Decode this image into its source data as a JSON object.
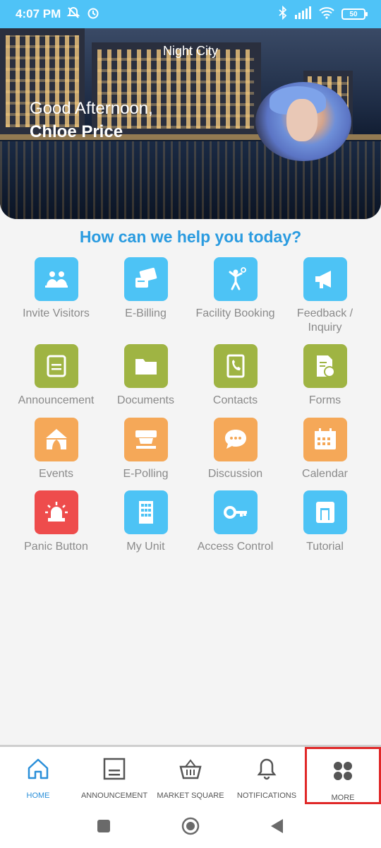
{
  "status_bar": {
    "time": "4:07 PM",
    "battery": "50",
    "icons": [
      "mute-icon",
      "alarm-icon",
      "bluetooth-icon",
      "signal-icon",
      "wifi-icon",
      "battery-icon"
    ]
  },
  "hero": {
    "location": "Night City",
    "greeting": "Good Afternoon,",
    "user_name": "Chloe Price"
  },
  "headline": "How can we help you today?",
  "services": [
    {
      "label": "Invite Visitors",
      "icon": "invite-visitors-icon",
      "color": "#4dc3f5"
    },
    {
      "label": "E-Billing",
      "icon": "billing-card-icon",
      "color": "#4dc3f5"
    },
    {
      "label": "Facility Booking",
      "icon": "badminton-player-icon",
      "color": "#4dc3f5"
    },
    {
      "label": "Feedback / Inquiry",
      "icon": "megaphone-icon",
      "color": "#4dc3f5"
    },
    {
      "label": "Announcement",
      "icon": "announcement-icon",
      "color": "#9fb443"
    },
    {
      "label": "Documents",
      "icon": "folder-icon",
      "color": "#9fb443"
    },
    {
      "label": "Contacts",
      "icon": "phone-book-icon",
      "color": "#9fb443"
    },
    {
      "label": "Forms",
      "icon": "form-icon",
      "color": "#9fb443"
    },
    {
      "label": "Events",
      "icon": "tent-icon",
      "color": "#f5a858"
    },
    {
      "label": "E-Polling",
      "icon": "ballot-icon",
      "color": "#f5a858"
    },
    {
      "label": "Discussion",
      "icon": "chat-bubble-icon",
      "color": "#f5a858"
    },
    {
      "label": "Calendar",
      "icon": "calendar-icon",
      "color": "#f5a858"
    },
    {
      "label": "Panic Button",
      "icon": "siren-icon",
      "color": "#ee4c4c"
    },
    {
      "label": "My Unit",
      "icon": "building-icon",
      "color": "#4dc3f5"
    },
    {
      "label": "Access Control",
      "icon": "key-icon",
      "color": "#4dc3f5"
    },
    {
      "label": "Tutorial",
      "icon": "tutorial-book-icon",
      "color": "#4dc3f5"
    }
  ],
  "bottom_nav": [
    {
      "label": "HOME",
      "icon": "home-icon",
      "active": true
    },
    {
      "label": "ANNOUNCEMENT",
      "icon": "announcement-icon"
    },
    {
      "label": "MARKET SQUARE",
      "icon": "basket-icon"
    },
    {
      "label": "NOTIFICATIONS",
      "icon": "bell-icon"
    },
    {
      "label": "MORE",
      "icon": "more-grid-icon",
      "highlighted": true
    }
  ],
  "colors": {
    "accent": "#2a9be0",
    "status_bar": "#4fc3f7",
    "highlight_box": "#e02828"
  }
}
